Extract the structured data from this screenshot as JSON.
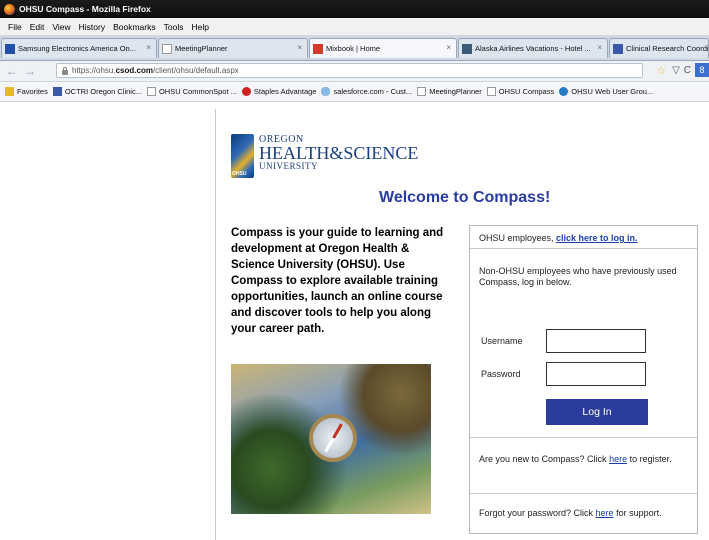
{
  "window": {
    "title": "OHSU Compass - Mozilla Firefox"
  },
  "menu": [
    "File",
    "Edit",
    "View",
    "History",
    "Bookmarks",
    "Tools",
    "Help"
  ],
  "tabs": [
    {
      "label": "Samsung Electronics America On...",
      "close": "×",
      "icon_color": "#1f4fa8"
    },
    {
      "label": "MeetingPlanner",
      "close": "×",
      "icon_color": "#ffffff"
    },
    {
      "label": "Mixbook | Home",
      "close": "×",
      "icon_color": "#d23a2a"
    },
    {
      "label": "Alaska Airlines Vacations - Hotel ...",
      "close": "×",
      "icon_color": "#3a5a7a"
    },
    {
      "label": "Clinical Research Coordinat",
      "close": "",
      "icon_color": "#3a5aa8"
    }
  ],
  "nav": {
    "back": "←",
    "forward": "→",
    "url_prefix": "https://ohsu.",
    "url_domain": "csod.com",
    "url_suffix": "/client/ohsu/default.aspx",
    "star": "☆",
    "dropdown": "▽",
    "reload": "C",
    "search_letter": "8"
  },
  "bookmarks": [
    {
      "label": "Favorites",
      "icon": "folder-icon",
      "color": "#e8b830"
    },
    {
      "label": "OCTRI Oregon Clinic...",
      "icon": "page-icon",
      "color": "#3a5aa8"
    },
    {
      "label": "OHSU CommonSpot ...",
      "icon": "blank-page-icon",
      "color": "#ffffff"
    },
    {
      "label": "Staples Advantage",
      "icon": "staples-icon",
      "color": "#d02020"
    },
    {
      "label": "salesforce.com - Cust...",
      "icon": "cloud-icon",
      "color": "#8ab8e0"
    },
    {
      "label": "MeetingPlanner",
      "icon": "blank-page-icon",
      "color": "#ffffff"
    },
    {
      "label": "OHSU Compass",
      "icon": "blank-page-icon",
      "color": "#ffffff"
    },
    {
      "label": "OHSU Web User Grou...",
      "icon": "sharepoint-icon",
      "color": "#2a78c8"
    }
  ],
  "logo": {
    "line1": "OREGON",
    "line2": "HEALTH&SCIENCE",
    "line3": "UNIVERSITY"
  },
  "welcome": "Welcome to Compass!",
  "intro": "Compass is your guide to learning and development at Oregon Health & Science University (OHSU). Use Compass to explore available training opportunities, launch an online course and discover tools to help you along your career path.",
  "login": {
    "employees_prefix": "OHSU employees, ",
    "employees_link": "click here to log in.",
    "non_ohsu": "Non-OHSU employees who have previously used Compass, log in below.",
    "username_label": "Username",
    "password_label": "Password",
    "button": "Log In",
    "new_prefix": "Are you new to Compass? Click ",
    "new_link": "here",
    "new_suffix": " to register.",
    "forgot_prefix": "Forgot your password? Click ",
    "forgot_link": "here",
    "forgot_suffix": " for support."
  }
}
